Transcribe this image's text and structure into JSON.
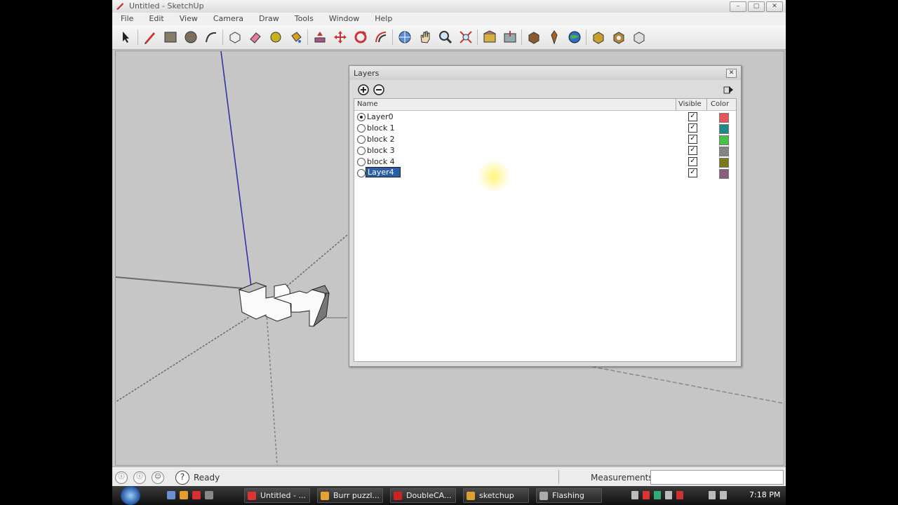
{
  "window": {
    "title": "Untitled - SketchUp"
  },
  "menu": [
    "File",
    "Edit",
    "View",
    "Camera",
    "Draw",
    "Tools",
    "Window",
    "Help"
  ],
  "layers_dialog": {
    "title": "Layers",
    "columns": {
      "name": "Name",
      "visible": "Visible",
      "color": "Color"
    },
    "rows": [
      {
        "name": "Layer0",
        "active": true,
        "visible": true,
        "color": "#e8585a"
      },
      {
        "name": "block 1",
        "active": false,
        "visible": true,
        "color": "#1f8a8a"
      },
      {
        "name": "block 2",
        "active": false,
        "visible": true,
        "color": "#4bc04b"
      },
      {
        "name": "block 3",
        "active": false,
        "visible": true,
        "color": "#858585"
      },
      {
        "name": "block 4",
        "active": false,
        "visible": true,
        "color": "#7c7a1e"
      },
      {
        "name": "Layer4",
        "active": false,
        "visible": true,
        "color": "#8a5c78",
        "editing": true
      }
    ]
  },
  "status": {
    "text": "Ready",
    "measurements_label": "Measurements"
  },
  "taskbar": {
    "tasks": [
      "Untitled - ...",
      "Burr puzzl...",
      "DoubleCA...",
      "sketchup",
      "Flashing"
    ],
    "clock": "7:18 PM"
  }
}
